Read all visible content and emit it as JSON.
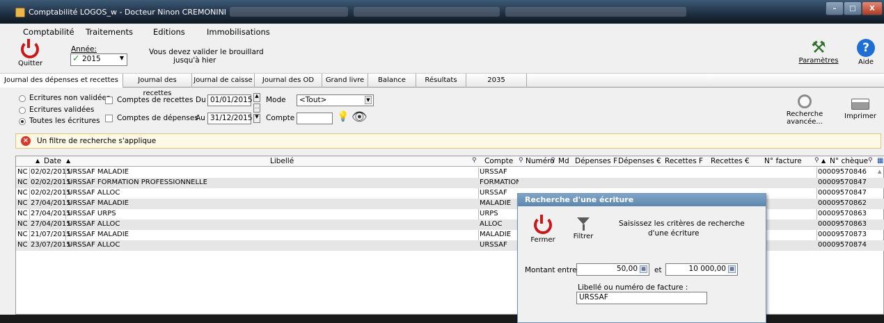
{
  "window": {
    "title": "Comptabilité LOGOS_w - Docteur Ninon CREMONINI"
  },
  "menu": [
    "Comptabilité",
    "Traitements",
    "Editions",
    "Immobilisations"
  ],
  "toolbar": {
    "quit": "Quitter",
    "year_label": "Année:",
    "year_value": "2015",
    "notice_line1": "Vous devez valider le brouillard",
    "notice_line2": "jusqu'à hier",
    "settings": "Paramètres",
    "help": "Aide",
    "help_glyph": "?"
  },
  "tabs": [
    "Journal des dépenses et recettes",
    "Journal des recettes",
    "Journal de caisse",
    "Journal des OD",
    "Grand livre",
    "Balance",
    "Résultats",
    "2035"
  ],
  "filters": {
    "radio_non_validees": "Ecritures non validées",
    "radio_validees": "Ecritures validées",
    "radio_toutes": "Toutes les écritures",
    "chk_recettes": "Comptes de recettes",
    "chk_depenses": "Comptes de dépenses",
    "du_label": "Du",
    "du_value": "01/01/2015",
    "au_label": "Au",
    "au_value": "31/12/2015",
    "mode_label": "Mode",
    "mode_value": "<Tout>",
    "compte_label": "Compte",
    "advanced_search_line1": "Recherche",
    "advanced_search_line2": "avancée...",
    "print": "Imprimer"
  },
  "filter_notice": "Un filtre de recherche s'applique",
  "table": {
    "headers": {
      "date": "Date",
      "libelle": "Libellé",
      "compte": "Compte",
      "numero": "Numéro",
      "md": "Md",
      "dep_f": "Dépenses F",
      "dep_e": "Dépenses €",
      "rec_f": "Recettes F",
      "rec_e": "Recettes €",
      "facture": "N° facture",
      "cheque": "N° chèque"
    },
    "rows": [
      {
        "type": "NC",
        "date": "02/02/2015",
        "libelle": "URSSAF MALADIE",
        "compte": "URSSAF",
        "cheque": "00009570846"
      },
      {
        "type": "NC",
        "date": "02/02/2015",
        "libelle": "URSSAF FORMATION PROFESSIONNELLE",
        "compte": "FORMATION",
        "cheque": "00009570847"
      },
      {
        "type": "NC",
        "date": "02/02/2015",
        "libelle": "URSSAF ALLOC",
        "compte": "URSSAF",
        "cheque": "00009570847"
      },
      {
        "type": "NC",
        "date": "27/04/2015",
        "libelle": "URSSAF MALADIE",
        "compte": "MALADIE",
        "cheque": "00009570862"
      },
      {
        "type": "NC",
        "date": "27/04/2015",
        "libelle": "URSSAF URPS",
        "compte": "URPS",
        "cheque": "00009570863"
      },
      {
        "type": "NC",
        "date": "27/04/2015",
        "libelle": "URSSAF ALLOC",
        "compte": "ALLOC",
        "cheque": "00009570863"
      },
      {
        "type": "NC",
        "date": "21/07/2015",
        "libelle": "URSSAF MALADIE",
        "compte": "MALADIE",
        "cheque": "00009570873"
      },
      {
        "type": "NC",
        "date": "23/07/2015",
        "libelle": "URSSAF ALLOC",
        "compte": "URSSAF",
        "cheque": "00009570874"
      }
    ]
  },
  "dialog": {
    "title": "Recherche d'une écriture",
    "close": "Fermer",
    "filter": "Filtrer",
    "instructions_line1": "Saisissez les critères de recherche",
    "instructions_line2": "d'une écriture",
    "amount_label": "Montant entre",
    "amount_min": "50,00",
    "and_label": "et",
    "amount_max": "10 000,00",
    "text_label": "Libellé ou numéro de facture :",
    "text_value": "URSSAF"
  },
  "colors": {
    "power_red": "#c91818",
    "help_blue": "#1d6fd6",
    "dialog_title": "#6e96bc",
    "filter_bg": "#fef8e6",
    "alert_red": "#d63a2a",
    "check_green": "#2e9a2e"
  },
  "icons": [
    "app-icon",
    "power-icon",
    "check-icon",
    "tools-icon",
    "help-icon",
    "magnifier-icon",
    "printer-icon",
    "lightbulb-icon",
    "eye-icon",
    "error-icon",
    "funnel-icon",
    "calendar-icon"
  ]
}
